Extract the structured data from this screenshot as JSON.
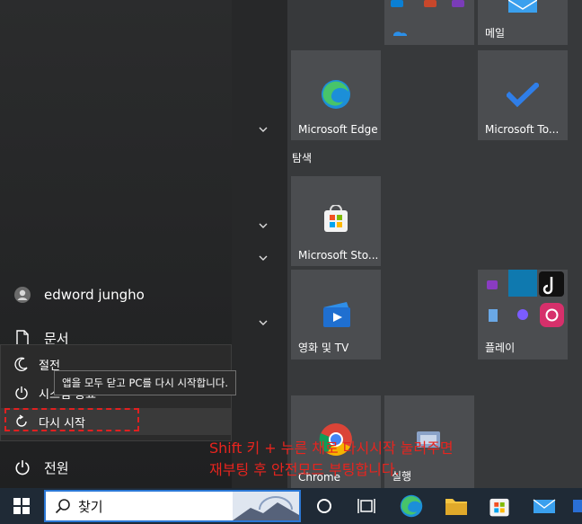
{
  "user": {
    "name": "edword jungho"
  },
  "nav": {
    "documents": "문서",
    "power": "전원"
  },
  "power_menu": {
    "sleep": "절전",
    "shutdown": "시스템 종료",
    "restart": "다시 시작",
    "tooltip": "앱을 모두 닫고 PC를 다시 시작합니다."
  },
  "groups": {
    "explore": "탐색"
  },
  "tiles": {
    "mail": "메일",
    "edge": "Microsoft Edge",
    "todo": "Microsoft To...",
    "store": "Microsoft Sto...",
    "movies": "영화 및 TV",
    "play": "플레이",
    "chrome": "Chrome",
    "backup": "실행"
  },
  "annotation": {
    "line1": "Shift 키 + 누른 채로 다시시작 눌러주면",
    "line2": "재부팅 후 안전모드 부팅합니다."
  },
  "taskbar": {
    "search_label": "찾기"
  },
  "colors": {
    "annotation_red": "#e8241e",
    "taskbar_bg": "#1f2a36",
    "search_border": "#2b78d6",
    "tile_bg": "#4b4d50"
  }
}
